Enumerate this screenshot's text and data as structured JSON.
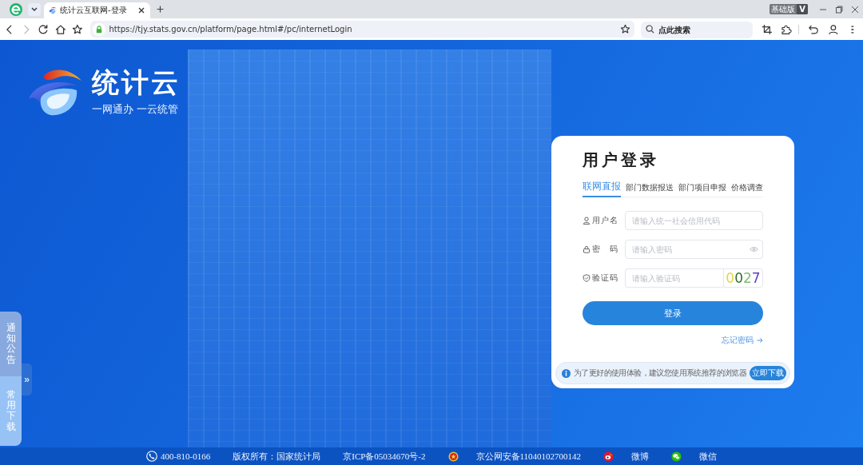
{
  "browser": {
    "tab_title": "统计云互联网-登录",
    "edition": {
      "label": "基础版",
      "mark": "V"
    },
    "nav": [
      {
        "kind": "back",
        "disabled": false
      },
      {
        "kind": "forward",
        "disabled": true
      },
      {
        "kind": "reload",
        "disabled": false
      },
      {
        "kind": "home",
        "disabled": false
      },
      {
        "kind": "bookmark",
        "disabled": false
      }
    ],
    "address": "https://tjy.stats.gov.cn/platform/page.html#/pc/internetLogin",
    "search": {
      "placeholder": "点此搜索"
    }
  },
  "brand": {
    "name": "统计云",
    "slogan": "一网通办 一云统管"
  },
  "side_panel": {
    "items": [
      {
        "label": "通知公告"
      },
      {
        "label": "常用下载"
      }
    ],
    "toggle": "»"
  },
  "login": {
    "title": "用户登录",
    "tabs": [
      {
        "label": "联网直报",
        "selected": true
      },
      {
        "label": "部门数据报送",
        "selected": false
      },
      {
        "label": "部门项目申报",
        "selected": false
      },
      {
        "label": "价格调查",
        "selected": false
      }
    ],
    "fields": [
      {
        "kind": "text",
        "label": "用户名",
        "placeholder": "请输入统一社会信用代码"
      },
      {
        "kind": "password",
        "label": "密　码",
        "placeholder": "请输入密码"
      },
      {
        "kind": "captcha",
        "label": "验证码",
        "placeholder": "请输入验证码",
        "captcha": "0027"
      }
    ],
    "submit": "登录",
    "forgot": "忘记密码",
    "notice": {
      "text": "为了更好的使用体验，建议您使用系统推荐的浏览器",
      "button": "立即下载"
    }
  },
  "footer": [
    {
      "kind": "phone",
      "text": "400-810-0166"
    },
    {
      "kind": "text",
      "text": "版权所有：国家统计局"
    },
    {
      "kind": "text",
      "text": "京ICP备05034670号-2"
    },
    {
      "kind": "police",
      "text": "京公网安备11040102700142"
    },
    {
      "kind": "weibo",
      "text": "微博"
    },
    {
      "kind": "wechat",
      "text": "微信"
    }
  ]
}
